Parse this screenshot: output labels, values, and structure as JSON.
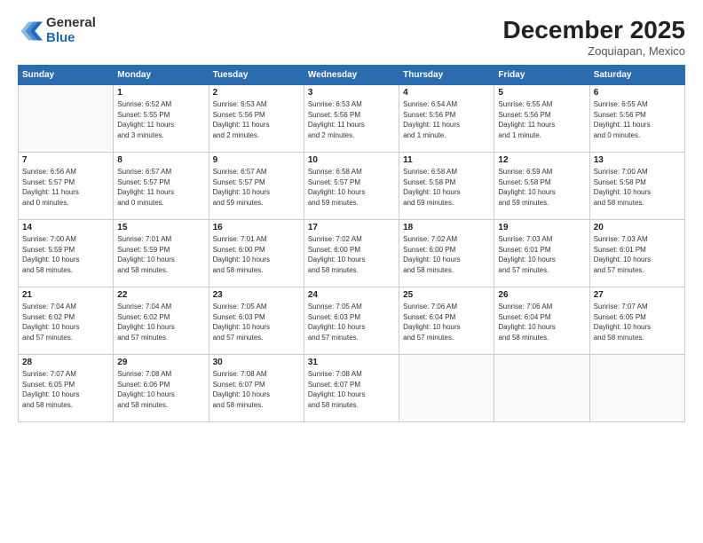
{
  "header": {
    "logo_general": "General",
    "logo_blue": "Blue",
    "month_title": "December 2025",
    "subtitle": "Zoquiapan, Mexico"
  },
  "days_of_week": [
    "Sunday",
    "Monday",
    "Tuesday",
    "Wednesday",
    "Thursday",
    "Friday",
    "Saturday"
  ],
  "weeks": [
    [
      {
        "day": "",
        "info": ""
      },
      {
        "day": "1",
        "info": "Sunrise: 6:52 AM\nSunset: 5:55 PM\nDaylight: 11 hours\nand 3 minutes."
      },
      {
        "day": "2",
        "info": "Sunrise: 6:53 AM\nSunset: 5:56 PM\nDaylight: 11 hours\nand 2 minutes."
      },
      {
        "day": "3",
        "info": "Sunrise: 6:53 AM\nSunset: 5:56 PM\nDaylight: 11 hours\nand 2 minutes."
      },
      {
        "day": "4",
        "info": "Sunrise: 6:54 AM\nSunset: 5:56 PM\nDaylight: 11 hours\nand 1 minute."
      },
      {
        "day": "5",
        "info": "Sunrise: 6:55 AM\nSunset: 5:56 PM\nDaylight: 11 hours\nand 1 minute."
      },
      {
        "day": "6",
        "info": "Sunrise: 6:55 AM\nSunset: 5:56 PM\nDaylight: 11 hours\nand 0 minutes."
      }
    ],
    [
      {
        "day": "7",
        "info": "Sunrise: 6:56 AM\nSunset: 5:57 PM\nDaylight: 11 hours\nand 0 minutes."
      },
      {
        "day": "8",
        "info": "Sunrise: 6:57 AM\nSunset: 5:57 PM\nDaylight: 11 hours\nand 0 minutes."
      },
      {
        "day": "9",
        "info": "Sunrise: 6:57 AM\nSunset: 5:57 PM\nDaylight: 10 hours\nand 59 minutes."
      },
      {
        "day": "10",
        "info": "Sunrise: 6:58 AM\nSunset: 5:57 PM\nDaylight: 10 hours\nand 59 minutes."
      },
      {
        "day": "11",
        "info": "Sunrise: 6:58 AM\nSunset: 5:58 PM\nDaylight: 10 hours\nand 59 minutes."
      },
      {
        "day": "12",
        "info": "Sunrise: 6:59 AM\nSunset: 5:58 PM\nDaylight: 10 hours\nand 59 minutes."
      },
      {
        "day": "13",
        "info": "Sunrise: 7:00 AM\nSunset: 5:58 PM\nDaylight: 10 hours\nand 58 minutes."
      }
    ],
    [
      {
        "day": "14",
        "info": "Sunrise: 7:00 AM\nSunset: 5:59 PM\nDaylight: 10 hours\nand 58 minutes."
      },
      {
        "day": "15",
        "info": "Sunrise: 7:01 AM\nSunset: 5:59 PM\nDaylight: 10 hours\nand 58 minutes."
      },
      {
        "day": "16",
        "info": "Sunrise: 7:01 AM\nSunset: 6:00 PM\nDaylight: 10 hours\nand 58 minutes."
      },
      {
        "day": "17",
        "info": "Sunrise: 7:02 AM\nSunset: 6:00 PM\nDaylight: 10 hours\nand 58 minutes."
      },
      {
        "day": "18",
        "info": "Sunrise: 7:02 AM\nSunset: 6:00 PM\nDaylight: 10 hours\nand 58 minutes."
      },
      {
        "day": "19",
        "info": "Sunrise: 7:03 AM\nSunset: 6:01 PM\nDaylight: 10 hours\nand 57 minutes."
      },
      {
        "day": "20",
        "info": "Sunrise: 7:03 AM\nSunset: 6:01 PM\nDaylight: 10 hours\nand 57 minutes."
      }
    ],
    [
      {
        "day": "21",
        "info": "Sunrise: 7:04 AM\nSunset: 6:02 PM\nDaylight: 10 hours\nand 57 minutes."
      },
      {
        "day": "22",
        "info": "Sunrise: 7:04 AM\nSunset: 6:02 PM\nDaylight: 10 hours\nand 57 minutes."
      },
      {
        "day": "23",
        "info": "Sunrise: 7:05 AM\nSunset: 6:03 PM\nDaylight: 10 hours\nand 57 minutes."
      },
      {
        "day": "24",
        "info": "Sunrise: 7:05 AM\nSunset: 6:03 PM\nDaylight: 10 hours\nand 57 minutes."
      },
      {
        "day": "25",
        "info": "Sunrise: 7:06 AM\nSunset: 6:04 PM\nDaylight: 10 hours\nand 57 minutes."
      },
      {
        "day": "26",
        "info": "Sunrise: 7:06 AM\nSunset: 6:04 PM\nDaylight: 10 hours\nand 58 minutes."
      },
      {
        "day": "27",
        "info": "Sunrise: 7:07 AM\nSunset: 6:05 PM\nDaylight: 10 hours\nand 58 minutes."
      }
    ],
    [
      {
        "day": "28",
        "info": "Sunrise: 7:07 AM\nSunset: 6:05 PM\nDaylight: 10 hours\nand 58 minutes."
      },
      {
        "day": "29",
        "info": "Sunrise: 7:08 AM\nSunset: 6:06 PM\nDaylight: 10 hours\nand 58 minutes."
      },
      {
        "day": "30",
        "info": "Sunrise: 7:08 AM\nSunset: 6:07 PM\nDaylight: 10 hours\nand 58 minutes."
      },
      {
        "day": "31",
        "info": "Sunrise: 7:08 AM\nSunset: 6:07 PM\nDaylight: 10 hours\nand 58 minutes."
      },
      {
        "day": "",
        "info": ""
      },
      {
        "day": "",
        "info": ""
      },
      {
        "day": "",
        "info": ""
      }
    ]
  ]
}
